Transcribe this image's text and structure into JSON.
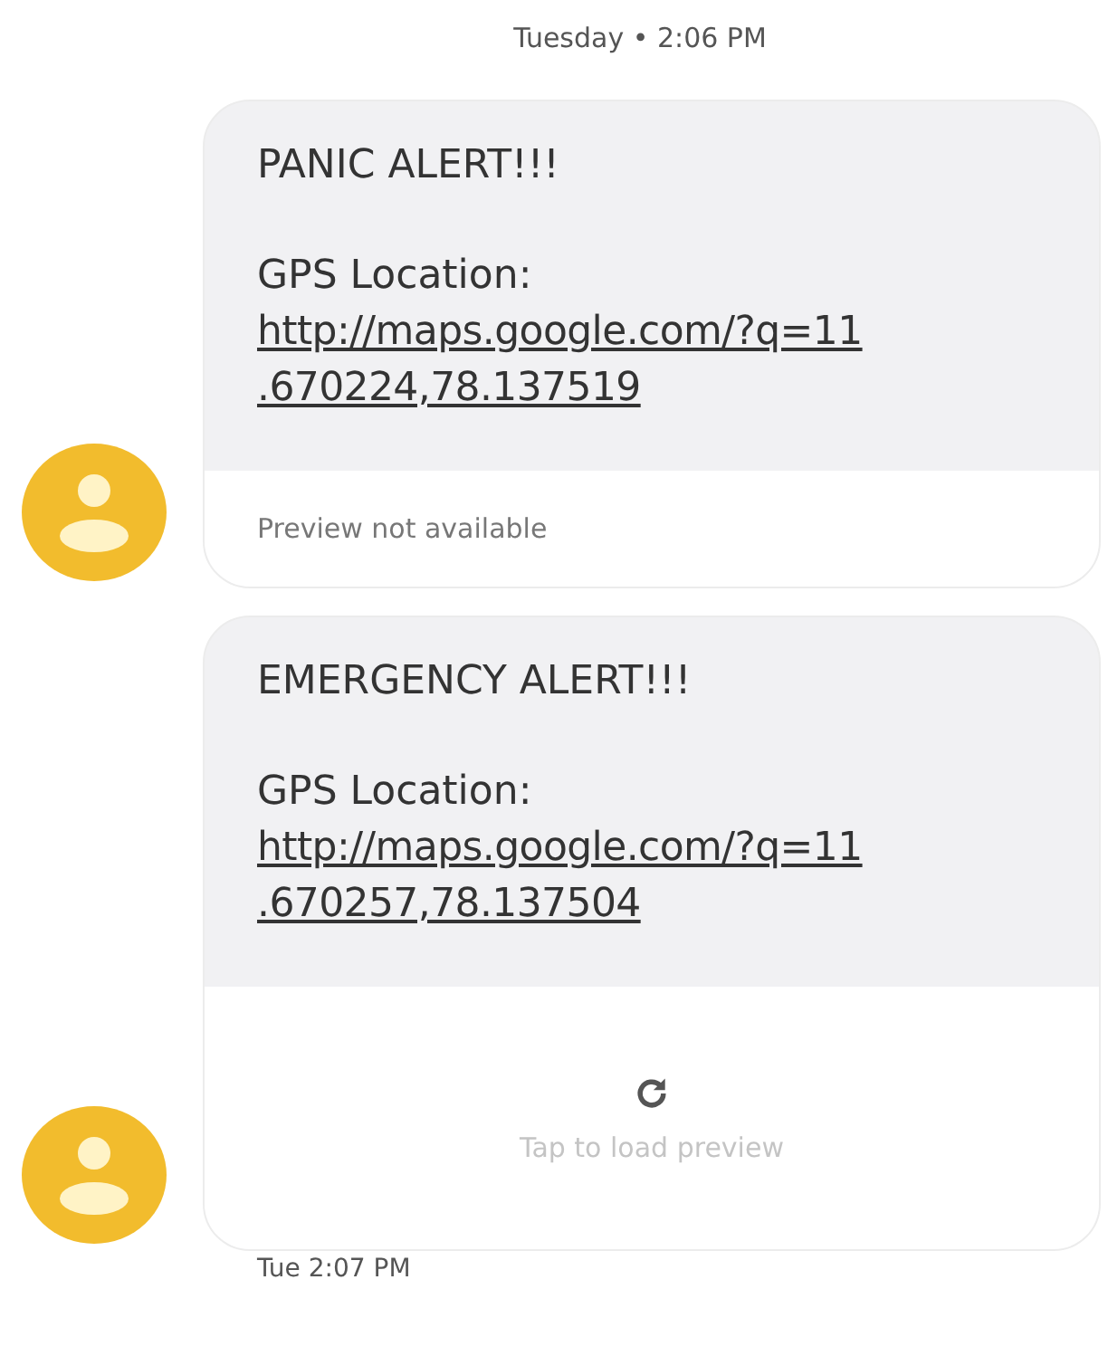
{
  "date_header": "Tuesday • 2:06 PM",
  "messages": [
    {
      "title": "PANIC ALERT!!!",
      "label": "GPS Location:",
      "link_lines": [
        "http://maps.google.com/?q=11",
        ".670224,78.137519"
      ],
      "preview": {
        "kind": "unavailable",
        "text": "Preview not available"
      }
    },
    {
      "title": "EMERGENCY ALERT!!!",
      "label": "GPS Location:",
      "link_lines": [
        "http://maps.google.com/?q=11",
        ".670257,78.137504"
      ],
      "preview": {
        "kind": "tap",
        "text": "Tap to load preview"
      }
    }
  ],
  "footer_time": "Tue 2:07 PM"
}
